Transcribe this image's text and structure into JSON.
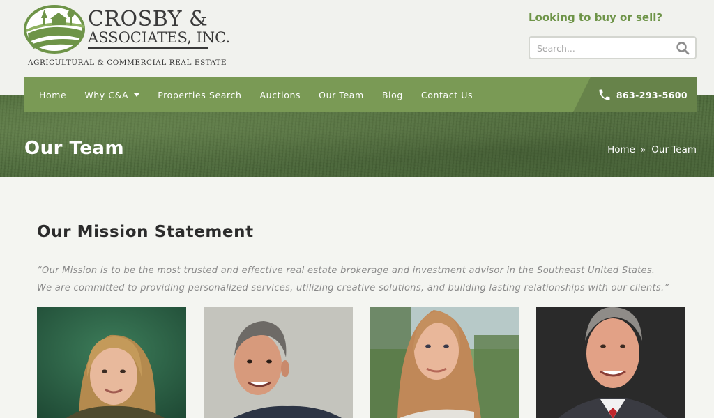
{
  "logo": {
    "line1": "CROSBY &",
    "line2": "ASSOCIATES, INC.",
    "tagline": "AGRICULTURAL & COMMERCIAL REAL ESTATE"
  },
  "header": {
    "cta": "Looking to buy or sell?",
    "search_placeholder": "Search..."
  },
  "nav": {
    "items": [
      {
        "label": "Home"
      },
      {
        "label": "Why C&A"
      },
      {
        "label": "Properties Search"
      },
      {
        "label": "Auctions"
      },
      {
        "label": "Our Team"
      },
      {
        "label": "Blog"
      },
      {
        "label": "Contact Us"
      }
    ],
    "phone": "863-293-5600"
  },
  "banner": {
    "title": "Our Team",
    "breadcrumb": [
      {
        "label": "Home"
      },
      {
        "label": "Our Team"
      }
    ],
    "separator": "»"
  },
  "mission": {
    "heading": "Our Mission Statement",
    "line1": "“Our Mission is to be the most trusted and effective real estate brokerage and investment advisor in the Southeast United States.",
    "line2": "We are committed to providing personalized services, utilizing creative solutions, and building lasting relationships with our clients.”"
  },
  "colors": {
    "brand_green": "#7a9a55",
    "brand_green_dark": "#67834a",
    "cta_green": "#6e9448",
    "text_dark": "#2b2b2b",
    "text_muted": "#8a8a8a"
  },
  "icons": [
    "search-icon",
    "phone-icon",
    "chevron-down-icon",
    "logo-emblem"
  ]
}
